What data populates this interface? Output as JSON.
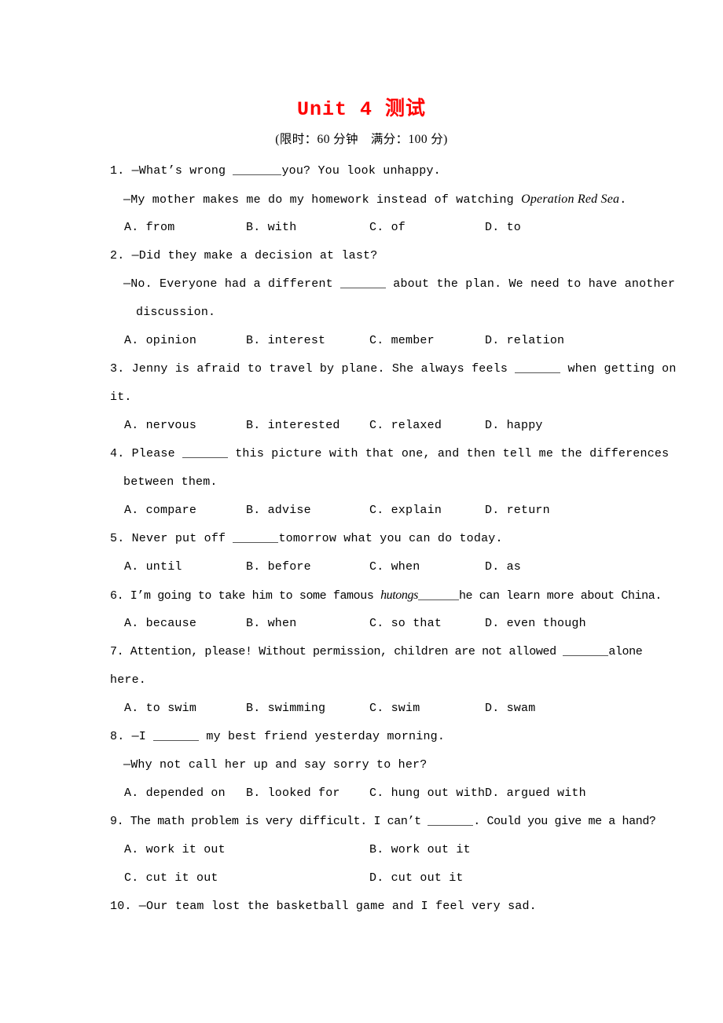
{
  "document": {
    "title": "Unit 4 测试",
    "title_color": "#ff0000",
    "subtitle": "(限时：60 分钟　满分：100 分)"
  },
  "questions": [
    {
      "number": "1.",
      "lines": [
        {
          "indent": 0,
          "pre": "1. —What’s wrong ",
          "blank": "w1",
          "post": "you? You look unhappy."
        },
        {
          "indent": 1,
          "pre": "—My mother makes me do my homework instead of watching ",
          "italic": "Operation Red Sea",
          "post": "."
        }
      ],
      "options": [
        {
          "col": "A",
          "label": "A. from"
        },
        {
          "col": "B",
          "label": "B. with"
        },
        {
          "col": "C",
          "label": "C. of"
        },
        {
          "col": "D",
          "label": "D. to"
        }
      ]
    },
    {
      "number": "2.",
      "lines": [
        {
          "indent": 0,
          "pre": "2. —Did they make a decision at last?",
          "post": ""
        },
        {
          "indent": 1,
          "pre": "—No. Everyone had a different ",
          "blank": "w2",
          "post": " about the plan. We need to have another"
        },
        {
          "indent": 2,
          "pre": "discussion.",
          "post": ""
        }
      ],
      "options": [
        {
          "col": "A",
          "label": "A. opinion"
        },
        {
          "col": "B",
          "label": "B. interest"
        },
        {
          "col": "C",
          "label": "C. member"
        },
        {
          "col": "D",
          "label": "D. relation"
        }
      ]
    },
    {
      "number": "3.",
      "lines": [
        {
          "indent": 0,
          "pre": "3. Jenny is afraid to travel by plane. She always feels ",
          "blank": "w2",
          "post": " when getting on"
        },
        {
          "indent": 0,
          "pre": "it.",
          "post": ""
        }
      ],
      "options": [
        {
          "col": "A",
          "label": "A. nervous"
        },
        {
          "col": "B",
          "label": "B. interested"
        },
        {
          "col": "C",
          "label": "C. relaxed"
        },
        {
          "col": "D",
          "label": "D. happy"
        }
      ]
    },
    {
      "number": "4.",
      "lines": [
        {
          "indent": 0,
          "pre": "4. Please ",
          "blank": "w2",
          "post": " this picture with that one, and then tell me the differences"
        },
        {
          "indent": 1,
          "pre": "between them.",
          "post": ""
        }
      ],
      "options": [
        {
          "col": "A",
          "label": "A. compare"
        },
        {
          "col": "B",
          "label": "B. advise"
        },
        {
          "col": "C",
          "label": "C. explain"
        },
        {
          "col": "D",
          "label": "D. return"
        }
      ]
    },
    {
      "number": "5.",
      "lines": [
        {
          "indent": 0,
          "pre": "5. Never put off ",
          "blank": "w2",
          "post": "tomorrow what you can do today."
        }
      ],
      "options": [
        {
          "col": "A",
          "label": "A. until"
        },
        {
          "col": "B",
          "label": "B. before"
        },
        {
          "col": "C",
          "label": "C. when"
        },
        {
          "col": "D",
          "label": "D. as"
        }
      ]
    },
    {
      "number": "6.",
      "lines": [
        {
          "indent": 0,
          "tight": true,
          "pre": "6. I’m going to take him to some famous ",
          "italic": "hutongs",
          "blank": "w3",
          "post": "he can learn more about China."
        }
      ],
      "options": [
        {
          "col": "A",
          "label": "A. because"
        },
        {
          "col": "B",
          "label": "B. when"
        },
        {
          "col": "C",
          "label": "C. so that"
        },
        {
          "col": "D",
          "label": "D. even though"
        }
      ]
    },
    {
      "number": "7.",
      "lines": [
        {
          "indent": 0,
          "tight": true,
          "pre": "7. Attention, please! Without permission, children are not allowed ",
          "blank": "w2",
          "post": "alone"
        },
        {
          "indent": 0,
          "pre": "here.",
          "post": ""
        }
      ],
      "options": [
        {
          "col": "A",
          "label": "A. to swim"
        },
        {
          "col": "B",
          "label": "B. swimming"
        },
        {
          "col": "C",
          "label": "C. swim"
        },
        {
          "col": "D",
          "label": "D. swam"
        }
      ]
    },
    {
      "number": "8.",
      "lines": [
        {
          "indent": 0,
          "pre": "8. —I ",
          "blank": "w2",
          "post": " my best friend yesterday morning."
        },
        {
          "indent": 1,
          "pre": "—Why not call her up and say sorry to her?",
          "post": ""
        }
      ],
      "options": [
        {
          "col": "A",
          "label": "A. depended on"
        },
        {
          "col": "B",
          "label": "B. looked for"
        },
        {
          "col": "C",
          "label": "C. hung out with"
        },
        {
          "col": "D",
          "label": "D. argued with"
        }
      ]
    },
    {
      "number": "9.",
      "lines": [
        {
          "indent": 0,
          "tight": true,
          "pre": "9. The math problem is very difficult. I can’t ",
          "blank": "w2",
          "post": ". Could you give me a hand?"
        }
      ],
      "options_wide": [
        {
          "col": "A",
          "label": "A. work it out"
        },
        {
          "col": "B",
          "label": "B. work out it"
        },
        {
          "col": "C",
          "label": "C. cut it out"
        },
        {
          "col": "D",
          "label": "D. cut out it"
        }
      ]
    },
    {
      "number": "10.",
      "lines": [
        {
          "indent": 0,
          "pre": "10. —Our team lost the basketball game and I feel very sad.",
          "post": ""
        }
      ]
    }
  ],
  "option_columns_note": {
    "A": "A",
    "B": "B",
    "C": "C",
    "D": "D"
  }
}
